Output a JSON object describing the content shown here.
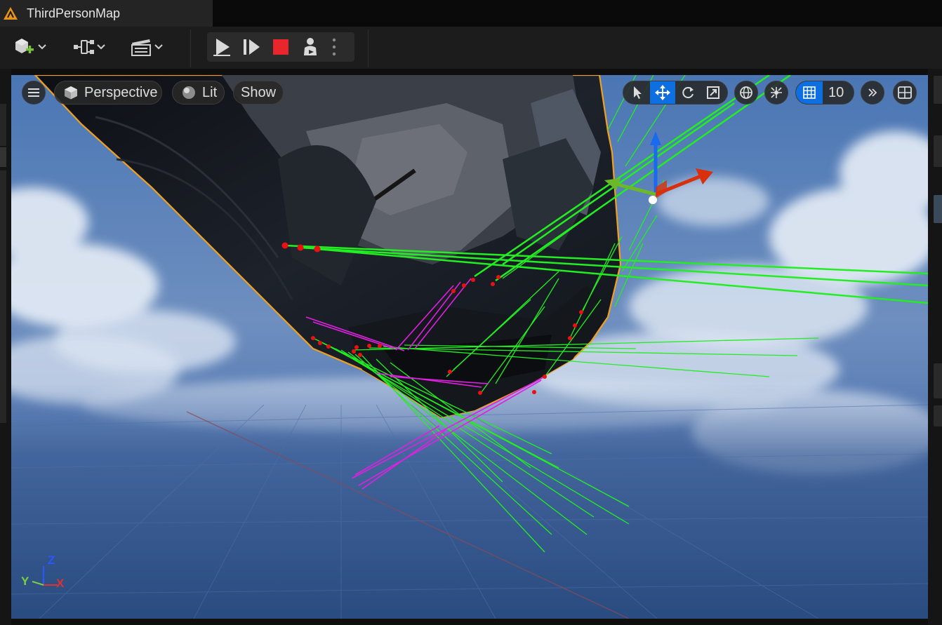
{
  "window": {
    "tab_title": "ThirdPersonMap",
    "tab_icon": "unreal-warning-icon"
  },
  "toolbar": {
    "left_buttons": [
      "add-actor-icon",
      "blueprint-icon",
      "cinematics-icon"
    ],
    "play_controls": [
      "play-icon",
      "step-frame-icon",
      "stop-icon",
      "possess-eject-icon",
      "more-options-icon"
    ],
    "accent_stop": "#e8262b"
  },
  "viewport": {
    "menu_icon": "hamburger-icon",
    "view_mode": "Perspective",
    "lighting_mode": "Lit",
    "show_label": "Show",
    "transform_tools": [
      "select-icon",
      "translate-icon",
      "rotate-icon",
      "scale-icon"
    ],
    "active_tool": "translate-icon",
    "grid_snap_value": "10",
    "colors": {
      "selection_outline": "#f0a020",
      "trace_hit": "#22ee22",
      "trace_miss": "#e020e0",
      "hit_point": "#ee1010"
    },
    "axis_indicator": {
      "x": "X",
      "y": "Y",
      "z": "Z"
    }
  }
}
